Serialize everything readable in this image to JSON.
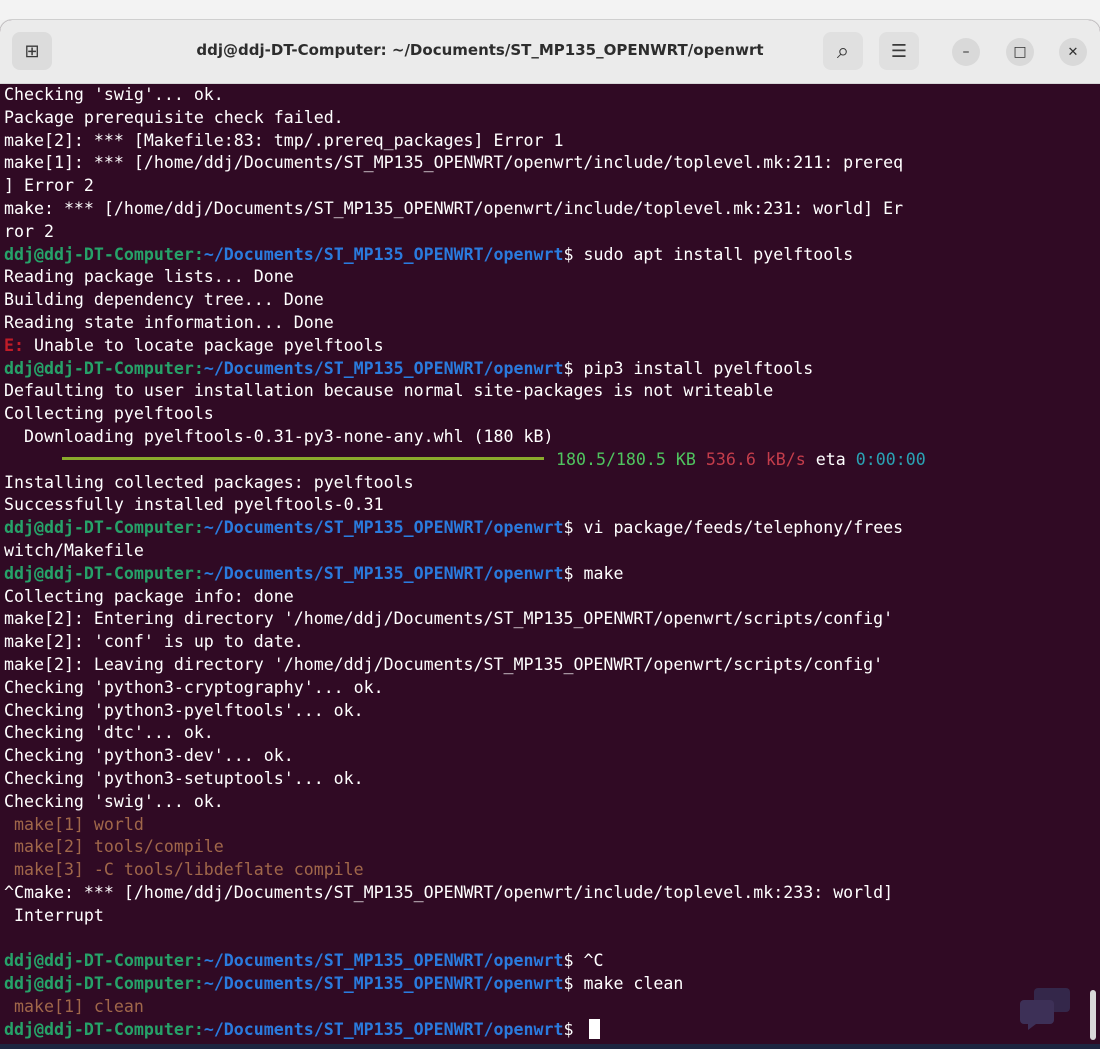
{
  "window": {
    "title": "ddj@ddj-DT-Computer: ~/Documents/ST_MP135_OPENWRT/openwrt",
    "icons": {
      "new_tab": "new-tab-icon",
      "search": "search-icon",
      "menu": "hamburger-menu-icon",
      "minimize": "minimize-icon",
      "maximize": "maximize-icon",
      "close": "close-icon"
    },
    "glyphs": {
      "new_tab": "⊞",
      "search": "⌕",
      "menu": "☰",
      "minimize": "–",
      "maximize": "□",
      "close": "✕"
    }
  },
  "prompt": {
    "user": "ddj@ddj-DT-Computer",
    "colon": ":",
    "path": "~/Documents/ST_MP135_OPENWRT/openwrt",
    "symbol": "$"
  },
  "colors": {
    "terminal_bg": "#300a24",
    "prompt_user": "#26a269",
    "prompt_path": "#2a7bde",
    "error": "#c01c28",
    "text": "#ffffff"
  },
  "terminal": {
    "lines": [
      {
        "type": "text",
        "text": "Checking 'swig'... ok."
      },
      {
        "type": "text",
        "text": "Package prerequisite check failed."
      },
      {
        "type": "text",
        "text": "make[2]: *** [Makefile:83: tmp/.prereq_packages] Error 1"
      },
      {
        "type": "text",
        "text": "make[1]: *** [/home/ddj/Documents/ST_MP135_OPENWRT/openwrt/include/toplevel.mk:211: prereq"
      },
      {
        "type": "text",
        "text": "] Error 2"
      },
      {
        "type": "text",
        "text": "make: *** [/home/ddj/Documents/ST_MP135_OPENWRT/openwrt/include/toplevel.mk:231: world] Er"
      },
      {
        "type": "text",
        "text": "ror 2"
      },
      {
        "type": "prompt",
        "cmd": " sudo apt install pyelftools"
      },
      {
        "type": "text",
        "text": "Reading package lists... Done"
      },
      {
        "type": "text",
        "text": "Building dependency tree... Done"
      },
      {
        "type": "text",
        "text": "Reading state information... Done"
      },
      {
        "type": "error",
        "label": "E:",
        "text": " Unable to locate package pyelftools"
      },
      {
        "type": "prompt",
        "cmd": " pip3 install pyelftools"
      },
      {
        "type": "text",
        "text": "Defaulting to user installation because normal site-packages is not writeable"
      },
      {
        "type": "text",
        "text": "Collecting pyelftools"
      },
      {
        "type": "text",
        "text": "  Downloading pyelftools-0.31-py3-none-any.whl (180 kB)"
      },
      {
        "type": "progress",
        "done": "180.5/180.5 KB",
        "speed": "536.6 kB/s",
        "eta_label": "eta",
        "eta": "0:00:00",
        "fraction": 1.0
      },
      {
        "type": "text",
        "text": "Installing collected packages: pyelftools"
      },
      {
        "type": "text",
        "text": "Successfully installed pyelftools-0.31"
      },
      {
        "type": "prompt",
        "cmd": " vi package/feeds/telephony/frees"
      },
      {
        "type": "text",
        "text": "witch/Makefile"
      },
      {
        "type": "prompt",
        "cmd": " make"
      },
      {
        "type": "text",
        "text": "Collecting package info: done"
      },
      {
        "type": "text",
        "text": "make[2]: Entering directory '/home/ddj/Documents/ST_MP135_OPENWRT/openwrt/scripts/config'"
      },
      {
        "type": "text",
        "text": "make[2]: 'conf' is up to date."
      },
      {
        "type": "text",
        "text": "make[2]: Leaving directory '/home/ddj/Documents/ST_MP135_OPENWRT/openwrt/scripts/config'"
      },
      {
        "type": "text",
        "text": "Checking 'python3-cryptography'... ok."
      },
      {
        "type": "text",
        "text": "Checking 'python3-pyelftools'... ok."
      },
      {
        "type": "text",
        "text": "Checking 'dtc'... ok."
      },
      {
        "type": "text",
        "text": "Checking 'python3-dev'... ok."
      },
      {
        "type": "text",
        "text": "Checking 'python3-setuptools'... ok."
      },
      {
        "type": "text",
        "text": "Checking 'swig'... ok."
      },
      {
        "type": "faint",
        "text": " make[1] world"
      },
      {
        "type": "faint",
        "text": " make[2] tools/compile"
      },
      {
        "type": "faint",
        "text": " make[3] -C tools/libdeflate compile"
      },
      {
        "type": "text",
        "text": "^Cmake: *** [/home/ddj/Documents/ST_MP135_OPENWRT/openwrt/include/toplevel.mk:233: world]"
      },
      {
        "type": "text",
        "text": " Interrupt"
      },
      {
        "type": "text",
        "text": ""
      },
      {
        "type": "prompt",
        "cmd": " ^C"
      },
      {
        "type": "prompt",
        "cmd": " make clean"
      },
      {
        "type": "faint",
        "text": " make[1] clean"
      },
      {
        "type": "prompt",
        "cmd": " ",
        "cursor": true
      }
    ]
  }
}
